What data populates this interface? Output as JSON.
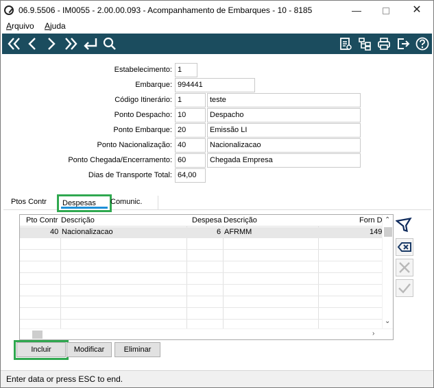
{
  "window": {
    "title": "06.9.5506 - IM0055 - 2.00.00.093 - Acompanhamento de Embarques - 10 - 8185",
    "minimize": "—",
    "close": "✕"
  },
  "menu": {
    "arquivo_first": "A",
    "arquivo_rest": "rquivo",
    "ajuda_first": "A",
    "ajuda_rest": "juda"
  },
  "toolbar": {
    "icons": [
      "first-record-icon",
      "prev-record-icon",
      "next-record-icon",
      "last-record-icon",
      "return-icon",
      "search-icon",
      "report-icon",
      "tree-icon",
      "print-icon",
      "exit-icon",
      "help-icon"
    ],
    "bg_color": "#1b4c5e"
  },
  "form": {
    "estabelecimento": {
      "label": "Estabelecimento:",
      "value": "1"
    },
    "embarque": {
      "label": "Embarque:",
      "value": "994441"
    },
    "codigo_itinerario": {
      "label": "Código Itinerário:",
      "value": "1",
      "desc": "teste"
    },
    "ponto_despacho": {
      "label": "Ponto Despacho:",
      "value": "10",
      "desc": "Despacho"
    },
    "ponto_embarque": {
      "label": "Ponto Embarque:",
      "value": "20",
      "desc": "Emissão LI"
    },
    "ponto_nacionalizacao": {
      "label": "Ponto Nacionalização:",
      "value": "40",
      "desc": "Nacionalizacao"
    },
    "ponto_chegada": {
      "label": "Ponto Chegada/Encerramento:",
      "value": "60",
      "desc": "Chegada Empresa"
    },
    "dias_transporte": {
      "label": "Dias de Transporte Total:",
      "value": "64,00"
    }
  },
  "tabs": {
    "pts_contr": "Ptos Contr",
    "despesas": "Despesas",
    "comunic": "Comunic."
  },
  "grid": {
    "columns": [
      "Pto Contr",
      "Descrição",
      "Despesa",
      "Descrição",
      "Forn D"
    ],
    "rows": [
      {
        "pto_contr": "40",
        "descricao": "Nacionalizacao",
        "despesa": "6",
        "descricao2": "AFRMM",
        "forn": "149"
      }
    ]
  },
  "buttons": {
    "incluir": "Incluir",
    "modificar": "Modificar",
    "eliminar": "Eliminar"
  },
  "status": {
    "text": "Enter data or press ESC to end."
  },
  "colors": {
    "highlight": "#2fa84f",
    "tab_underline": "#1d8fd8"
  }
}
